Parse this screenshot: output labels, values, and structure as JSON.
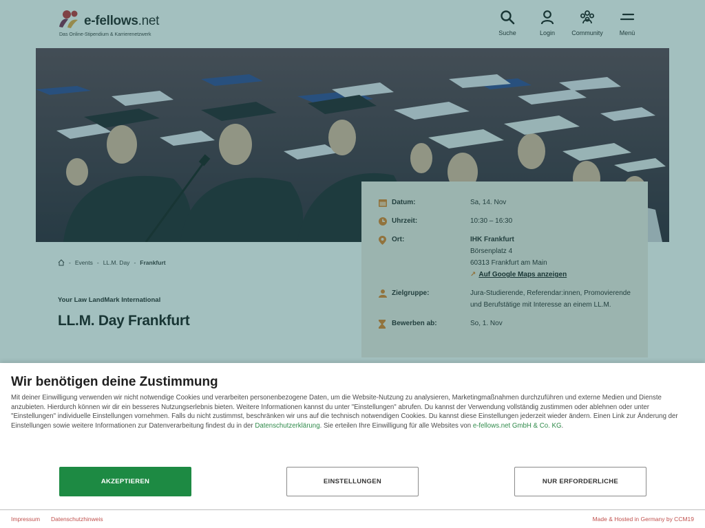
{
  "header": {
    "logo_text": "e-fellows",
    "logo_suffix": ".net",
    "tagline": "Das Online-Stipendium & Karrierenetzwerk",
    "nav": [
      {
        "label": "Suche",
        "icon": "search-icon"
      },
      {
        "label": "Login",
        "icon": "user-icon"
      },
      {
        "label": "Community",
        "icon": "community-icon"
      },
      {
        "label": "Menü",
        "icon": "menu-icon"
      }
    ]
  },
  "hero": {
    "image": "graduates-caps-photo"
  },
  "event": {
    "breadcrumb": [
      "Events",
      "LL.M. Day",
      "Frankfurt"
    ],
    "kicker": "Your Law LandMark International",
    "title": "LL.M. Day Frankfurt"
  },
  "info": {
    "date_label": "Datum:",
    "date_value": "Sa, 14. Nov",
    "date_icon": "calendar-icon",
    "time_label": "Uhrzeit:",
    "time_value": "10:30 – 16:30",
    "time_icon": "clock-icon",
    "place_label": "Ort:",
    "place_icon": "location-pin-icon",
    "place_lines": [
      "IHK Frankfurt",
      "Börsenplatz 4",
      "60313 Frankfurt am Main"
    ],
    "maps_link": "Auf Google Maps anzeigen",
    "target_label": "Zielgruppe:",
    "target_icon": "person-icon",
    "target_value": "Jura-Studierende, Referendar:innen, Promovierende und Berufstätige mit Interesse an einem LL.M.",
    "apply_label": "Bewerben ab:",
    "apply_value": "So, 1. Nov",
    "apply_icon": "hourglass-icon"
  },
  "consent": {
    "title": "Wir benötigen deine Zustimmung",
    "text_part1": "Mit deiner Einwilligung verwenden wir nicht notwendige Cookies und verarbeiten personenbezogene Daten, um die Website-Nutzung zu analysieren, Marketingmaßnahmen durchzuführen und externe Medien und Dienste anzubieten. Hierdurch können wir dir ein besseres Nutzungserlebnis bieten. Weitere Informationen kannst du unter \"Einstellungen\" abrufen. Du kannst der Verwendung vollständig zustimmen oder ablehnen oder unter \"Einstellungen\" individuelle Einstellungen vornehmen. Falls du nicht zustimmst, beschränken wir uns auf die technisch notwendigen Cookies. Du kannst diese Einstellungen jederzeit wieder ändern. Einen Link zur Änderung der Einstellungen sowie weitere Informationen zur Datenverarbeitung findest du in der ",
    "link_privacy": "Datenschutzerklärung",
    "text_part2": ". Sie erteilen Ihre Einwilligung für alle Websites von ",
    "link_company": "e-fellows.net GmbH & Co. KG",
    "text_part3": ".",
    "accept_label": "AKZEPTIEREN",
    "settings_label": "EINSTELLUNGEN",
    "required_label": "NUR ERFORDERLICHE",
    "footer_imprint": "Impressum",
    "footer_privacy": "Datenschutzhinweis",
    "footer_hosted": "Made & Hosted in Germany by CCM19"
  },
  "colors": {
    "overlay": "#2f7c79",
    "accept": "#1d8a43",
    "link_green": "#2f8a4a",
    "footer_link": "#c0504d",
    "icon_orange": "#e07a1f"
  }
}
